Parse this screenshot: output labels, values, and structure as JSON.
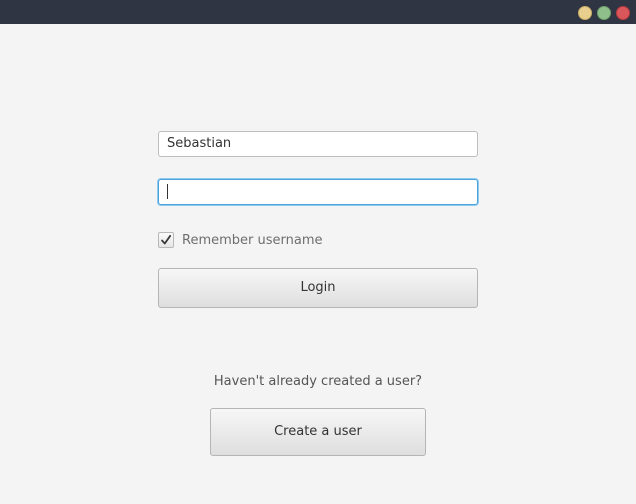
{
  "window": {
    "buttons": {
      "minimize_color": "#e8cf8e",
      "maximize_color": "#8fbf8a",
      "close_color": "#d9565a"
    }
  },
  "login": {
    "username_value": "Sebastian",
    "password_value": "",
    "remember_label": "Remember username",
    "remember_checked": true,
    "login_button_label": "Login"
  },
  "signup": {
    "hint_text": "Haven't already created a user?",
    "create_button_label": "Create a user"
  },
  "colors": {
    "titlebar": "#2f3542",
    "background": "#f4f4f4",
    "focus_border": "#4ba3d9"
  }
}
